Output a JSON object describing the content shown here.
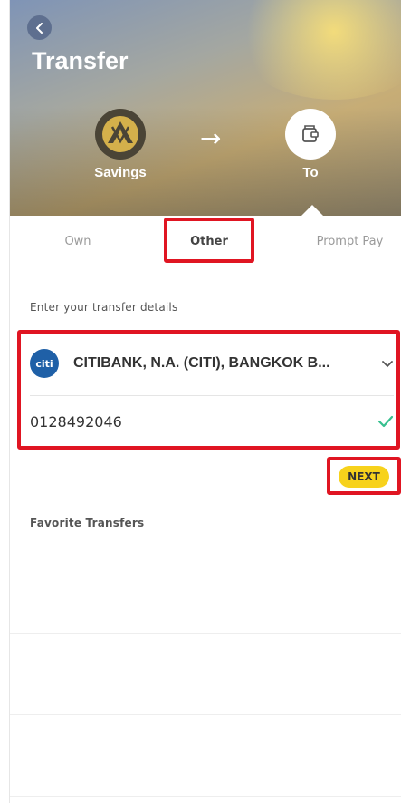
{
  "header": {
    "title": "Transfer",
    "from_label": "Savings",
    "to_label": "To"
  },
  "tabs": [
    {
      "label": "Own",
      "active": false
    },
    {
      "label": "Other",
      "active": true
    },
    {
      "label": "Prompt Pay",
      "active": false
    }
  ],
  "form": {
    "section_title": "Enter your transfer details",
    "bank_logo_text": "citi",
    "bank_name": "CITIBANK, N.A. (CITI), BANGKOK B...",
    "account_number": "0128492046",
    "next_label": "NEXT"
  },
  "favorites": {
    "title": "Favorite Transfers"
  },
  "colors": {
    "accent_yellow": "#f7d21c",
    "highlight_red": "#e01522",
    "check_green": "#37c08f",
    "citi_blue": "#1f60a7"
  },
  "icons": {
    "back": "back-icon",
    "arrow": "right-arrow-icon",
    "to": "wallet-icon",
    "chevron": "chevron-down-icon",
    "check": "check-icon"
  }
}
